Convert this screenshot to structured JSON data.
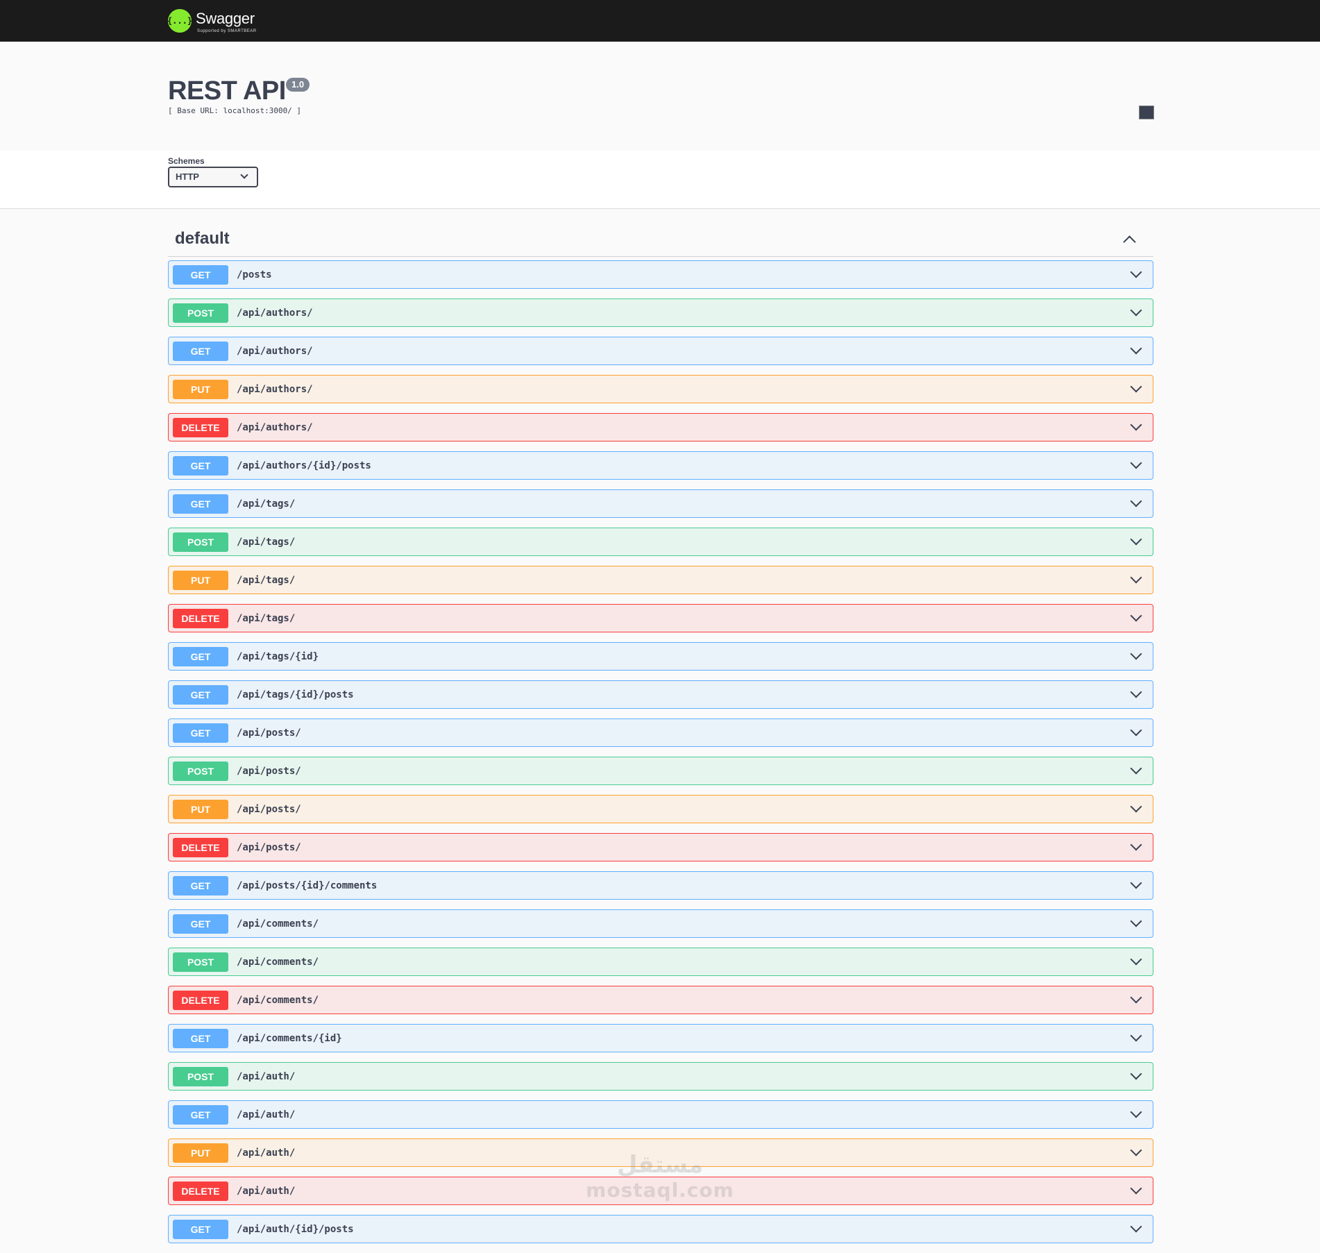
{
  "topbar": {
    "logo_name": "Swagger",
    "logo_sub": "Supported by SMARTBEAR",
    "logo_glyph": "{...}"
  },
  "info": {
    "title": "REST API",
    "version": "1.0",
    "base_url": "[ Base URL: localhost:3000/ ]"
  },
  "schemes": {
    "label": "Schemes",
    "selected": "HTTP"
  },
  "section": {
    "title": "default"
  },
  "operations": [
    {
      "method": "GET",
      "path": "/posts"
    },
    {
      "method": "POST",
      "path": "/api/authors/"
    },
    {
      "method": "GET",
      "path": "/api/authors/"
    },
    {
      "method": "PUT",
      "path": "/api/authors/"
    },
    {
      "method": "DELETE",
      "path": "/api/authors/"
    },
    {
      "method": "GET",
      "path": "/api/authors/{id}/posts"
    },
    {
      "method": "GET",
      "path": "/api/tags/"
    },
    {
      "method": "POST",
      "path": "/api/tags/"
    },
    {
      "method": "PUT",
      "path": "/api/tags/"
    },
    {
      "method": "DELETE",
      "path": "/api/tags/"
    },
    {
      "method": "GET",
      "path": "/api/tags/{id}"
    },
    {
      "method": "GET",
      "path": "/api/tags/{id}/posts"
    },
    {
      "method": "GET",
      "path": "/api/posts/"
    },
    {
      "method": "POST",
      "path": "/api/posts/"
    },
    {
      "method": "PUT",
      "path": "/api/posts/"
    },
    {
      "method": "DELETE",
      "path": "/api/posts/"
    },
    {
      "method": "GET",
      "path": "/api/posts/{id}/comments"
    },
    {
      "method": "GET",
      "path": "/api/comments/"
    },
    {
      "method": "POST",
      "path": "/api/comments/"
    },
    {
      "method": "DELETE",
      "path": "/api/comments/"
    },
    {
      "method": "GET",
      "path": "/api/comments/{id}"
    },
    {
      "method": "POST",
      "path": "/api/auth/"
    },
    {
      "method": "GET",
      "path": "/api/auth/"
    },
    {
      "method": "PUT",
      "path": "/api/auth/"
    },
    {
      "method": "DELETE",
      "path": "/api/auth/"
    },
    {
      "method": "GET",
      "path": "/api/auth/{id}/posts"
    }
  ],
  "watermark": {
    "arabic": "مستقل",
    "latin": "mostaql.com"
  },
  "colors": {
    "get": "#61affe",
    "post": "#49cc90",
    "put": "#fca130",
    "delete": "#f93e3e",
    "topbar": "#1b1b1b",
    "logo": "#85ea2d"
  }
}
